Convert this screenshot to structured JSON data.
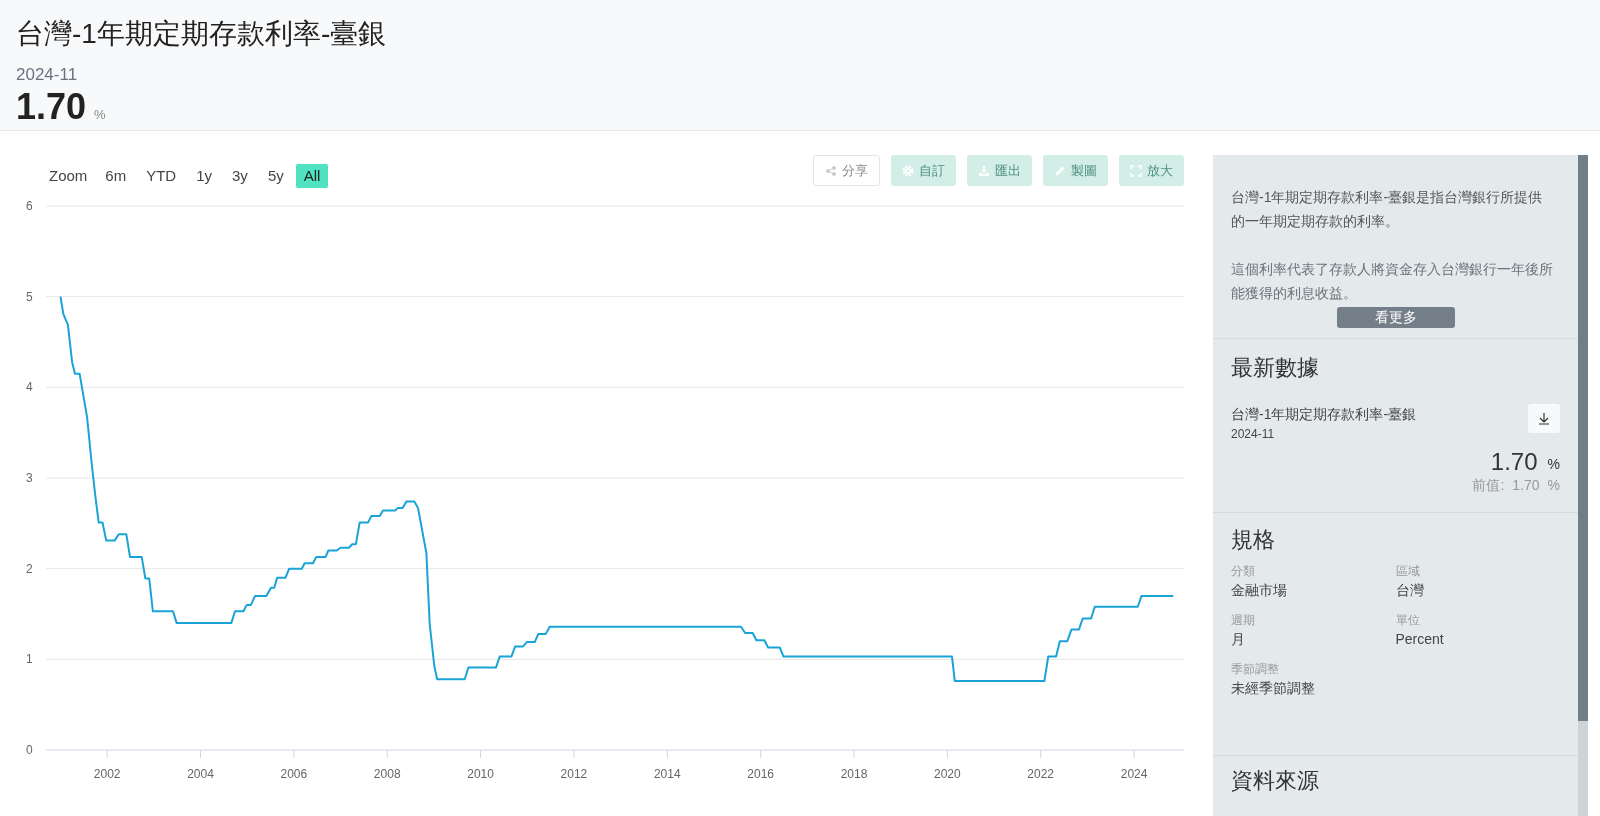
{
  "header": {
    "title": "台灣-1年期定期存款利率-臺銀",
    "date": "2024-11",
    "value": "1.70",
    "unit": "%"
  },
  "range_selector": {
    "label": "Zoom",
    "buttons": [
      {
        "label": "6m",
        "selected": false
      },
      {
        "label": "YTD",
        "selected": false
      },
      {
        "label": "1y",
        "selected": false
      },
      {
        "label": "3y",
        "selected": false
      },
      {
        "label": "5y",
        "selected": false
      },
      {
        "label": "All",
        "selected": true
      }
    ]
  },
  "actions": [
    {
      "label": "分享",
      "kind": "outline"
    },
    {
      "label": "自訂",
      "kind": "filled"
    },
    {
      "label": "匯出",
      "kind": "filled"
    },
    {
      "label": "製圖",
      "kind": "filled"
    },
    {
      "label": "放大",
      "kind": "filled"
    }
  ],
  "chart_data": {
    "type": "line",
    "grid": true,
    "xlim": [
      2000.69,
      2025.07
    ],
    "ylim": [
      0,
      6
    ],
    "yticks": [
      0,
      1,
      2,
      3,
      4,
      5,
      6
    ],
    "xticks": [
      2002,
      2004,
      2006,
      2008,
      2010,
      2012,
      2014,
      2016,
      2018,
      2020,
      2022,
      2024
    ],
    "x": [
      2001.0,
      2001.06,
      2001.16,
      2001.25,
      2001.31,
      2001.41,
      2001.57,
      2001.67,
      2001.74,
      2001.82,
      2001.9,
      2001.98,
      2002.16,
      2002.25,
      2002.41,
      2002.49,
      2002.74,
      2002.82,
      2002.9,
      2002.98,
      2003.41,
      2003.49,
      2004.66,
      2004.74,
      2004.92,
      2004.99,
      2005.08,
      2005.17,
      2005.41,
      2005.51,
      2005.58,
      2005.64,
      2005.82,
      2005.9,
      2006.17,
      2006.23,
      2006.41,
      2006.48,
      2006.68,
      2006.74,
      2006.92,
      2007.0,
      2007.18,
      2007.25,
      2007.33,
      2007.41,
      2007.59,
      2007.66,
      2007.84,
      2007.91,
      2008.17,
      2008.23,
      2008.33,
      2008.41,
      2008.58,
      2008.66,
      2008.84,
      2008.91,
      2009.01,
      2009.07,
      2009.66,
      2009.74,
      2010.33,
      2010.41,
      2010.66,
      2010.74,
      2010.91,
      2010.99,
      2011.16,
      2011.24,
      2011.4,
      2011.48,
      2015.58,
      2015.67,
      2015.83,
      2015.91,
      2016.08,
      2016.16,
      2016.41,
      2016.49,
      2020.1,
      2020.16,
      2022.08,
      2022.16,
      2022.33,
      2022.41,
      2022.57,
      2022.66,
      2022.82,
      2022.9,
      2023.08,
      2023.16,
      2024.08,
      2024.16,
      2024.84
    ],
    "series": [
      {
        "color": "#1aa3d6",
        "values": [
          5.0,
          4.81,
          4.69,
          4.28,
          4.15,
          4.15,
          3.67,
          3.16,
          2.83,
          2.51,
          2.51,
          2.31,
          2.31,
          2.38,
          2.38,
          2.13,
          2.13,
          1.89,
          1.89,
          1.53,
          1.53,
          1.4,
          1.4,
          1.53,
          1.53,
          1.6,
          1.6,
          1.7,
          1.7,
          1.79,
          1.79,
          1.9,
          1.9,
          2.0,
          2.0,
          2.06,
          2.06,
          2.13,
          2.13,
          2.2,
          2.2,
          2.23,
          2.23,
          2.27,
          2.27,
          2.51,
          2.51,
          2.58,
          2.58,
          2.64,
          2.64,
          2.67,
          2.67,
          2.74,
          2.74,
          2.67,
          2.17,
          1.39,
          0.92,
          0.78,
          0.78,
          0.91,
          0.91,
          1.03,
          1.03,
          1.14,
          1.14,
          1.19,
          1.19,
          1.28,
          1.28,
          1.36,
          1.36,
          1.29,
          1.29,
          1.21,
          1.21,
          1.13,
          1.13,
          1.03,
          1.03,
          0.76,
          0.76,
          1.03,
          1.03,
          1.2,
          1.2,
          1.33,
          1.33,
          1.45,
          1.45,
          1.58,
          1.58,
          1.7,
          1.7
        ]
      }
    ]
  },
  "description": [
    "台灣-1年期定期存款利率-臺銀是指台灣銀行所提供的一年期定期存款的利率。",
    "這個利率代表了存款人將資金存入台灣銀行一年後所能獲得的利息收益。"
  ],
  "more_button": "看更多",
  "latest": {
    "heading": "最新數據",
    "name": "台灣-1年期定期存款利率-臺銀",
    "date": "2024-11",
    "value": "1.70",
    "unit": "%",
    "previous_label": "前值:",
    "previous_value": "1.70",
    "previous_unit": "%"
  },
  "spec": {
    "heading": "規格",
    "fields": [
      {
        "label": "分類",
        "value": "金融市場"
      },
      {
        "label": "區域",
        "value": "台灣"
      },
      {
        "label": "週期",
        "value": "月"
      },
      {
        "label": "單位",
        "value": "Percent"
      },
      {
        "label": "季節調整",
        "value": "未經季節調整"
      }
    ]
  },
  "source": {
    "heading": "資料來源"
  }
}
